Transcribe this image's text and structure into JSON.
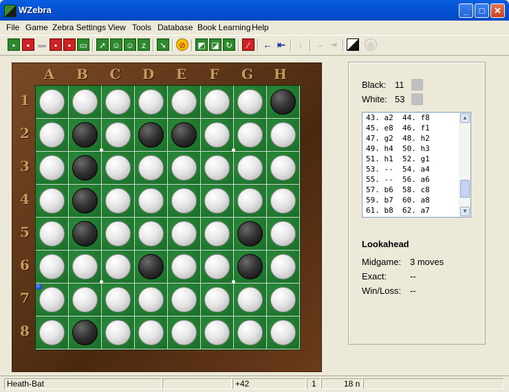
{
  "window": {
    "title": "WZebra"
  },
  "title_buttons": {
    "minimize": "_",
    "maximize": "□",
    "close": "✕"
  },
  "menu": [
    "File",
    "Game",
    "Zebra Settings",
    "View",
    "Tools",
    "Database",
    "Book Learning",
    "Help"
  ],
  "toolbar_icons": [
    "new-game-icon",
    "open-icon",
    "save-icon",
    "print-icon",
    "record-icon",
    "folder-icon",
    "analyze-icon",
    "players-icon",
    "players-2-icon",
    "zz-icon",
    "download-icon",
    "stop-icon",
    "green-square-icon",
    "green-square-2-icon",
    "rotate-icon",
    "clear-board-icon",
    "back-icon",
    "first-icon",
    "down-icon",
    "forward-icon",
    "last-icon",
    "color-swap-icon",
    "globe-icon"
  ],
  "board": {
    "columns": [
      "A",
      "B",
      "C",
      "D",
      "E",
      "F",
      "G",
      "H"
    ],
    "rows": [
      "1",
      "2",
      "3",
      "4",
      "5",
      "6",
      "7",
      "8"
    ],
    "position": [
      "WWWWWWWB",
      "WBWBBWWW",
      "WBWWWWWW",
      "WBWWWWWW",
      "WBWWWWBW",
      "WWWBWWBW",
      "WWWWWWWW",
      "WBWWWWWW"
    ]
  },
  "score": {
    "black_label": "Black:",
    "black": "11",
    "white_label": "White:",
    "white": "53"
  },
  "moves": [
    "43. a2  44. f8",
    "45. e8  46. f1",
    "47. g2  48. h2",
    "49. h4  50. h3",
    "51. h1  52. g1",
    "53. --  54. a4",
    "55. --  56. a6",
    "57. b6  58. c8",
    "59. b7  60. a8",
    "61. b8  62. a7"
  ],
  "lookahead": {
    "heading": "Lookahead",
    "midgame_label": "Midgame:",
    "midgame": "3 moves",
    "exact_label": "Exact:",
    "exact": "--",
    "winloss_label": "Win/Loss:",
    "winloss": "--"
  },
  "status": {
    "player": "Heath-Bat",
    "eval": "+42",
    "count": "1",
    "nodes": "18 n"
  }
}
